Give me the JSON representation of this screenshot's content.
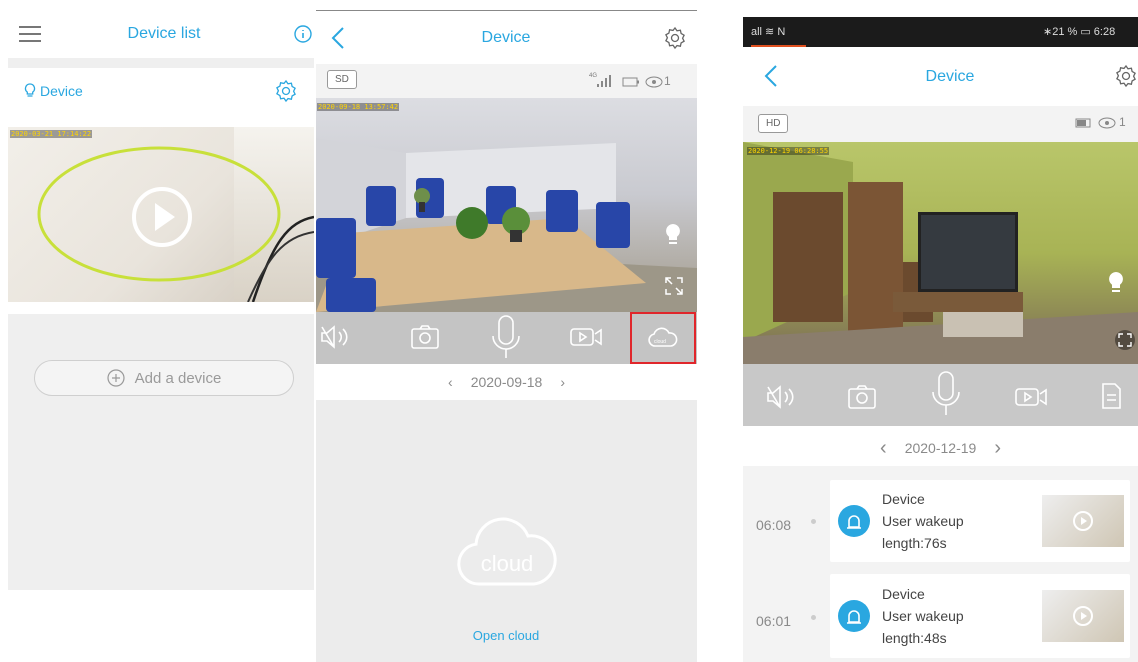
{
  "panel1": {
    "title": "Device list",
    "device_name": "Device",
    "timestamp": "2020-03-21 17:14:22",
    "add_device_label": "Add a device"
  },
  "panel2": {
    "title": "Device",
    "quality": "SD",
    "signal_label": "4G",
    "viewer_count": "1",
    "timestamp": "2020-09-18 13:57:42",
    "date": "2020-09-18",
    "cloud_text": "cloud",
    "open_cloud_label": "Open cloud",
    "cloud_button_text": "cloud"
  },
  "panel3": {
    "status_left": "all ≋ N",
    "status_right": "∗21 % ▭ 6:28",
    "title": "Device",
    "quality": "HD",
    "viewer_count": "1",
    "timestamp": "2020-12-19 06:28:55",
    "date": "2020-12-19",
    "events": [
      {
        "time": "06:08",
        "device": "Device",
        "type": "User wakeup",
        "length": "length:76s"
      },
      {
        "time": "06:01",
        "device": "Device",
        "type": "User wakeup",
        "length": "length:48s"
      }
    ]
  },
  "colors": {
    "accent": "#2aa7e0",
    "highlight_ring": "#c8e03a",
    "highlight_box": "#e0262b"
  }
}
